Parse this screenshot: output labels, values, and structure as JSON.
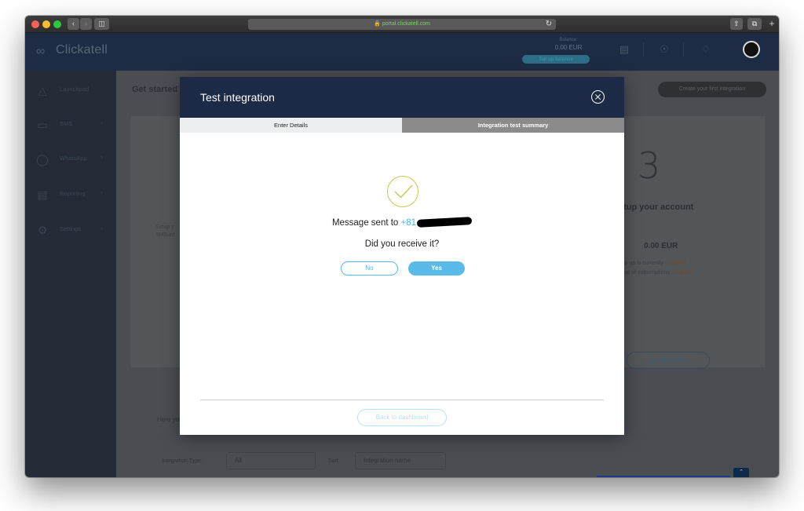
{
  "browser": {
    "url": "portal.clickatell.com"
  },
  "header": {
    "logo_text": "Clickatell",
    "balance_label": "Balance:",
    "balance_value": "0.00 EUR",
    "topup_label": "Top up balance"
  },
  "sidebar": {
    "items": [
      {
        "label": "Launchpad",
        "icon": "rocket-icon"
      },
      {
        "label": "SMS",
        "icon": "sms-icon"
      },
      {
        "label": "WhatsApp",
        "icon": "whatsapp-icon"
      },
      {
        "label": "Reporting",
        "icon": "chart-icon"
      },
      {
        "label": "Settings",
        "icon": "gear-icon"
      }
    ]
  },
  "page": {
    "title": "Get started",
    "create_button": "Create your first integration",
    "step_left_1": "Setup y",
    "step_left_2": "SMS int",
    "step_number": "3",
    "step_title": "etup your account",
    "step_amount": "0.00 EUR",
    "topup_note": "o top up is currently",
    "topup_status": "disabled",
    "renewal_note": "newal of subscriptions",
    "renewal_status": "disabled",
    "setup_billing": "Setup billing",
    "here_text": "Here you can s",
    "filter_type_label": "Integration Type:",
    "filter_type_value": "All",
    "sort_label": "Sort:",
    "sort_value": "Integration name"
  },
  "modal": {
    "title": "Test integration",
    "tabs": [
      {
        "label": "Enter Details",
        "active": false
      },
      {
        "label": "Integration test summary",
        "active": true
      }
    ],
    "message_prefix": "Message sent to",
    "phone_prefix": "+81",
    "question": "Did you receive it?",
    "no_label": "No",
    "yes_label": "Yes",
    "back_label": "Back to dashboard"
  },
  "colors": {
    "brand_navy": "#1c2a45",
    "accent_blue": "#5bbbe8",
    "check_green": "#c7c94d"
  }
}
